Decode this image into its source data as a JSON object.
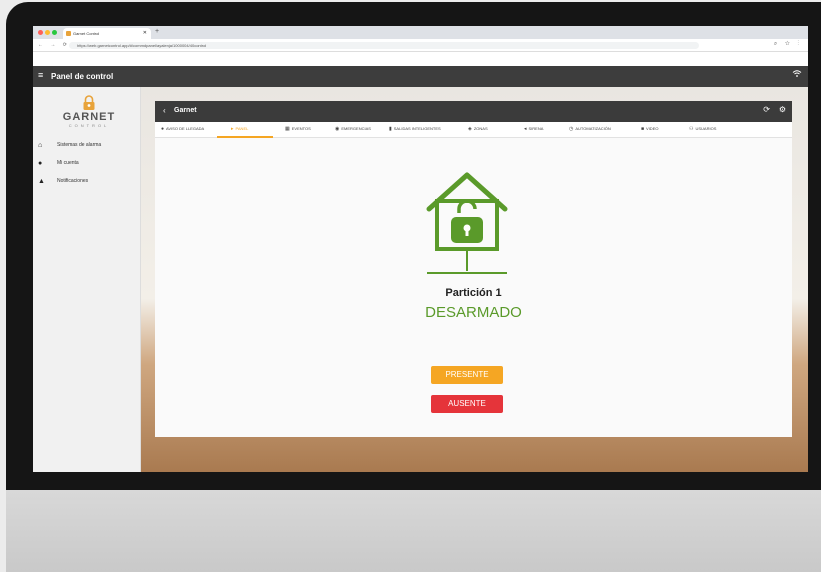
{
  "browser": {
    "tab_title": "Garnet Control",
    "url": "https://web.garnetcontrol.app/#/commdpanel/ayalenja/1000004/40control"
  },
  "toolbar": {
    "title": "Panel de control"
  },
  "sidebar": {
    "logo_brand": "GARNET",
    "logo_sub": "CONTROL",
    "items": [
      {
        "label": "Sistemas de alarma",
        "icon": "home-icon"
      },
      {
        "label": "Mi cuenta",
        "icon": "user-icon"
      },
      {
        "label": "Notificaciones",
        "icon": "bell-icon"
      }
    ]
  },
  "card": {
    "title": "Garnet",
    "tabs": [
      {
        "label": "AVISO DE LLEGADA",
        "icon": "arrival-icon"
      },
      {
        "label": "PANEL",
        "icon": "play-icon"
      },
      {
        "label": "EVENTOS",
        "icon": "calendar-icon"
      },
      {
        "label": "EMERGENCIAS",
        "icon": "alert-icon"
      },
      {
        "label": "SALIDAS INTELIGENTES",
        "icon": "plug-icon"
      },
      {
        "label": "ZONAS",
        "icon": "zones-icon"
      },
      {
        "label": "SIRENA",
        "icon": "speaker-icon"
      },
      {
        "label": "AUTOMATIZACIÓN",
        "icon": "clock-icon"
      },
      {
        "label": "VIDEO",
        "icon": "video-icon"
      },
      {
        "label": "USUARIOS",
        "icon": "users-icon"
      }
    ],
    "active_tab": "PANEL"
  },
  "status": {
    "partition": "Partición 1",
    "state": "DESARMADO",
    "present_button": "PRESENTE",
    "absent_button": "AUSENTE"
  },
  "colors": {
    "accent": "#f5a623",
    "danger": "#e5343a",
    "disarmed_green": "#5a9a2a",
    "toolbar": "#3d3d3d"
  }
}
